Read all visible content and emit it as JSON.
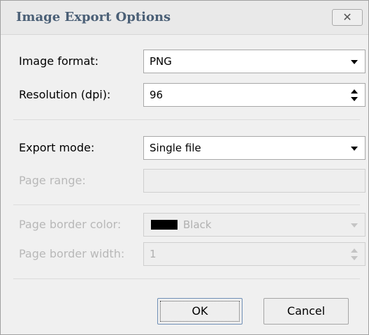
{
  "dialog": {
    "title": "Image Export Options",
    "close_glyph": "✕",
    "close_icon": "close-icon"
  },
  "fields": {
    "image_format": {
      "label": "Image format:",
      "value": "PNG"
    },
    "resolution": {
      "label": "Resolution (dpi):",
      "value": "96"
    },
    "export_mode": {
      "label": "Export mode:",
      "value": "Single file"
    },
    "page_range": {
      "label": "Page range:",
      "value": ""
    },
    "page_border_color": {
      "label": "Page border color:",
      "value": "Black",
      "swatch": "#000000"
    },
    "page_border_width": {
      "label": "Page border width:",
      "value": "1"
    }
  },
  "buttons": {
    "ok": "OK",
    "cancel": "Cancel"
  },
  "colors": {
    "title": "#4a5f76",
    "disabled_text": "#b8b8b8",
    "dialog_bg": "#f0f0f0"
  }
}
